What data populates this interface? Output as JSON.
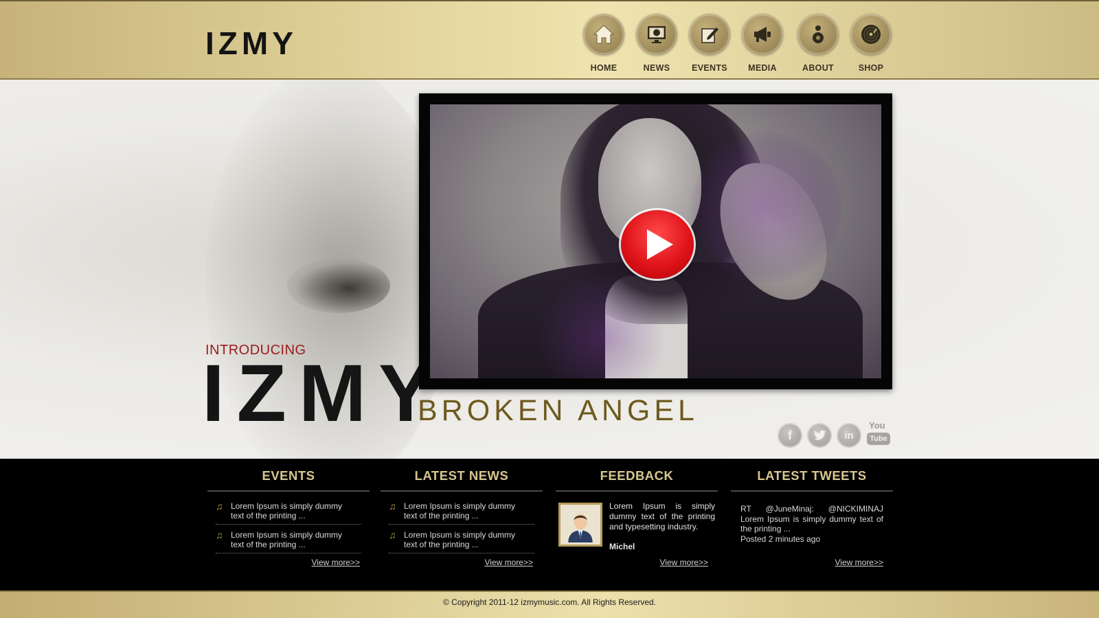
{
  "brand": {
    "logo": "IZMY"
  },
  "nav": {
    "items": [
      {
        "label": "HOME",
        "icon": "home-icon"
      },
      {
        "label": "NEWS",
        "icon": "monitor-globe-icon"
      },
      {
        "label": "EVENTS",
        "icon": "edit-note-icon"
      },
      {
        "label": "MEDIA",
        "icon": "megaphone-icon"
      },
      {
        "label": "ABOUT",
        "icon": "speaker-icon"
      },
      {
        "label": "SHOP",
        "icon": "vinyl-record-icon"
      }
    ]
  },
  "hero": {
    "intro": "INTRODUCING",
    "title": "IZMY",
    "subtitle": "BROKEN ANGEL"
  },
  "social": [
    "facebook-icon",
    "twitter-icon",
    "linkedin-icon",
    "youtube-icon"
  ],
  "social_labels": {
    "linkedin": "in",
    "facebook": "f",
    "youtube_top": "You",
    "youtube_bottom": "Tube"
  },
  "events": {
    "title": "EVENTS",
    "items": [
      "Lorem Ipsum is simply dummy text of the printing ...",
      "Lorem Ipsum is simply dummy text of the printing ..."
    ],
    "view_more": "View more>>"
  },
  "news": {
    "title": "LATEST NEWS",
    "items": [
      "Lorem Ipsum is simply dummy text of the printing ...",
      "Lorem Ipsum is simply dummy text of the printing ..."
    ],
    "view_more": "View more>>"
  },
  "feedback": {
    "title": "FEEDBACK",
    "text": "Lorem Ipsum is simply dummy text of the printing and typesetting industry.",
    "author": "Michel",
    "view_more": "View more>>"
  },
  "tweets": {
    "title": "LATEST TWEETS",
    "text": "RT @JuneMinaj: @NICKIMINAJ Lorem Ipsum is simply dummy text of the printing ...",
    "posted": "Posted 2 minutes ago",
    "view_more": "View more>>"
  },
  "footer": {
    "copyright": "© Copyright 2011-12 izmymusic.com. All Rights Reserved."
  },
  "colors": {
    "gold": "#d8c791",
    "accent_red": "#9b1a1a",
    "subtitle_gold": "#6e5a1e",
    "play_red": "#e0141a"
  }
}
